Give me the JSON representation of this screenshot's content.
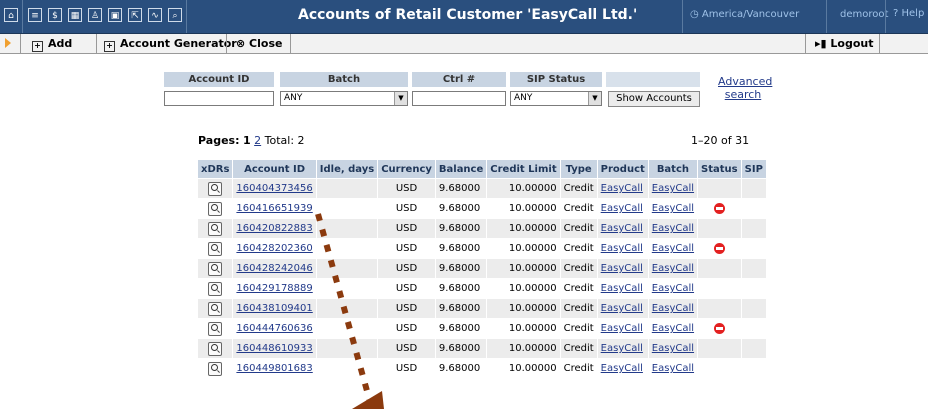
{
  "topbar": {
    "icons": [
      "home-icon",
      "list-icon",
      "dollar-icon",
      "grid-icon",
      "user-icon",
      "device-icon",
      "export-icon",
      "chart-icon",
      "search-icon"
    ],
    "title": "Accounts of Retail Customer 'EasyCall Ltd.'",
    "timezone": "America/Vancouver",
    "timezone_icon": "clock-icon",
    "user": "demoroot",
    "help": "Help"
  },
  "toolbar": {
    "add_label": "Add",
    "generator_label": "Account Generator",
    "close_label": "Close",
    "logout_label": "Logout"
  },
  "search": {
    "account_id_header": "Account ID",
    "batch_header": "Batch",
    "ctrl_header": "Ctrl #",
    "sip_header": "SIP Status",
    "account_id_value": "",
    "batch_value": "ANY",
    "ctrl_value": "",
    "sip_value": "ANY",
    "show_button": "Show Accounts",
    "advanced_line1": "Advanced",
    "advanced_line2": "search"
  },
  "pagination": {
    "pages_label": "Pages:",
    "current": "1",
    "page2": "2",
    "total": "Total: 2",
    "range": "1–20 of 31"
  },
  "table": {
    "headers": [
      "xDRs",
      "Account ID",
      "Idle, days",
      "Currency",
      "Balance",
      "Credit Limit",
      "Type",
      "Product",
      "Batch",
      "Status",
      "SIP"
    ],
    "rows": [
      {
        "id": "160404373456",
        "currency": "USD",
        "balance": "9.68000",
        "credit": "10.00000",
        "type": "Credit",
        "product": "EasyCall",
        "batch": "EasyCall",
        "blocked": false
      },
      {
        "id": "160416651939",
        "currency": "USD",
        "balance": "9.68000",
        "credit": "10.00000",
        "type": "Credit",
        "product": "EasyCall",
        "batch": "EasyCall",
        "blocked": true
      },
      {
        "id": "160420822883",
        "currency": "USD",
        "balance": "9.68000",
        "credit": "10.00000",
        "type": "Credit",
        "product": "EasyCall",
        "batch": "EasyCall",
        "blocked": false
      },
      {
        "id": "160428202360",
        "currency": "USD",
        "balance": "9.68000",
        "credit": "10.00000",
        "type": "Credit",
        "product": "EasyCall",
        "batch": "EasyCall",
        "blocked": true
      },
      {
        "id": "160428242046",
        "currency": "USD",
        "balance": "9.68000",
        "credit": "10.00000",
        "type": "Credit",
        "product": "EasyCall",
        "batch": "EasyCall",
        "blocked": false
      },
      {
        "id": "160429178889",
        "currency": "USD",
        "balance": "9.68000",
        "credit": "10.00000",
        "type": "Credit",
        "product": "EasyCall",
        "batch": "EasyCall",
        "blocked": false
      },
      {
        "id": "160438109401",
        "currency": "USD",
        "balance": "9.68000",
        "credit": "10.00000",
        "type": "Credit",
        "product": "EasyCall",
        "batch": "EasyCall",
        "blocked": false
      },
      {
        "id": "160444760636",
        "currency": "USD",
        "balance": "9.68000",
        "credit": "10.00000",
        "type": "Credit",
        "product": "EasyCall",
        "batch": "EasyCall",
        "blocked": true
      },
      {
        "id": "160448610933",
        "currency": "USD",
        "balance": "9.68000",
        "credit": "10.00000",
        "type": "Credit",
        "product": "EasyCall",
        "batch": "EasyCall",
        "blocked": false
      },
      {
        "id": "160449801683",
        "currency": "USD",
        "balance": "9.68000",
        "credit": "10.00000",
        "type": "Credit",
        "product": "EasyCall",
        "batch": "EasyCall",
        "blocked": false
      }
    ]
  },
  "colors": {
    "topbar": "#2a4f7e",
    "header_cell": "#c8d4e2",
    "link": "#223a8a",
    "blocked": "#e32020",
    "annotation": "#8b3a0e"
  }
}
